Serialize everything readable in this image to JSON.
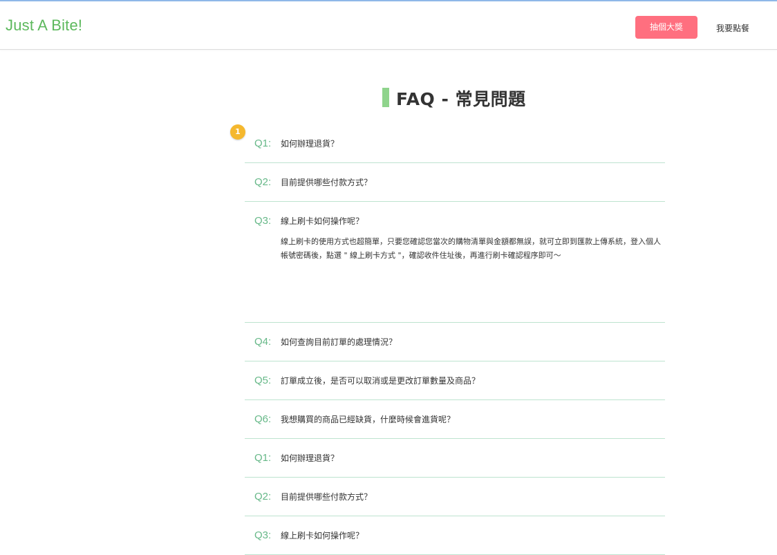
{
  "navbar": {
    "brand": "Just A Bite!",
    "lottery_label": "抽個大獎",
    "order_label": "我要點餐"
  },
  "page": {
    "title": "FAQ - 常見問題",
    "marker_label": "1"
  },
  "faq": [
    {
      "num": "Q1:",
      "question": "如何辦理退貨？"
    },
    {
      "num": "Q2:",
      "question": "目前提供哪些付款方式？"
    },
    {
      "num": "Q3:",
      "question": "線上刷卡如何操作呢？",
      "answer": "線上刷卡的使用方式也超簡單，只要您確認您當次的購物清單與金額都無誤，就可立即到匯款上傳系統，登入個人帳號密碼後，點選 \" 線上刷卡方式 \"，確認收件住址後，再進行刷卡確認程序即可～"
    },
    {
      "num": "Q4:",
      "question": "如何查詢目前訂單的處理情況？"
    },
    {
      "num": "Q5:",
      "question": "訂單成立後，是否可以取消或是更改訂單數量及商品？"
    },
    {
      "num": "Q6:",
      "question": "我想購買的商品已經缺貨，什麼時候會進貨呢？"
    },
    {
      "num": "Q1:",
      "question": "如何辦理退貨？"
    },
    {
      "num": "Q2:",
      "question": "目前提供哪些付款方式？"
    },
    {
      "num": "Q3:",
      "question": "線上刷卡如何操作呢？"
    }
  ],
  "colors": {
    "brand": "#5cb85c",
    "lottery_button": "#ff6f7f",
    "question_number": "#66b888",
    "divider": "#bde3cf",
    "title_accent": "#8fd48c",
    "marker": "#f5b82e"
  }
}
